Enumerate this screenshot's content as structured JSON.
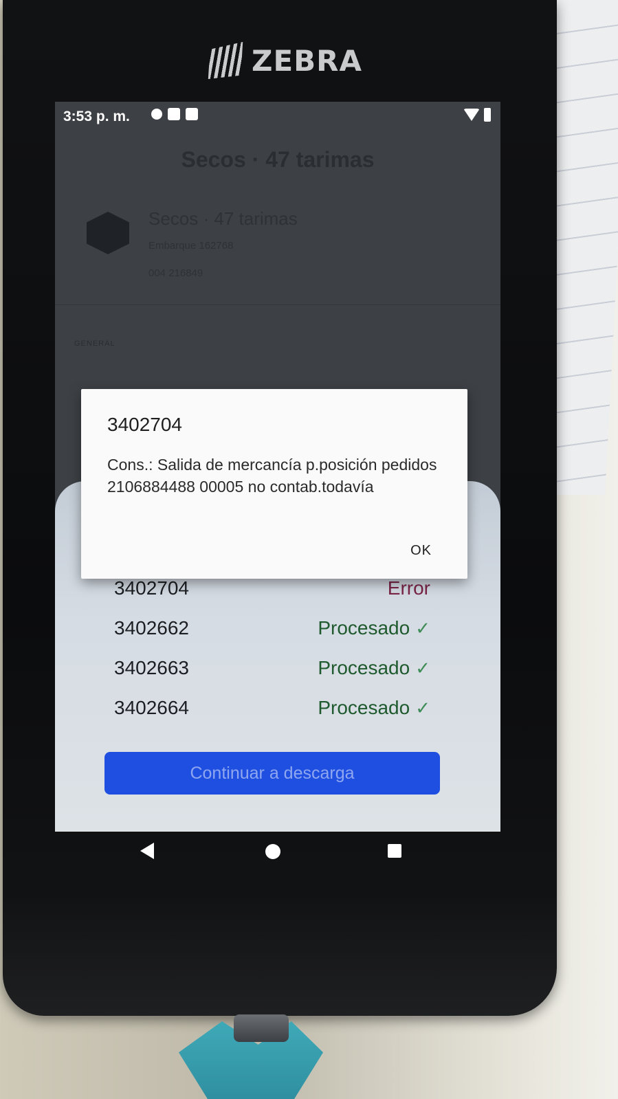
{
  "device": {
    "brand": "ZEBRA"
  },
  "statusbar": {
    "time": "3:53 p. m."
  },
  "background": {
    "title": "Secos · 47 tarimas",
    "card_title": "Secos · 47 tarimas",
    "card_sub1": "Embarque 162768",
    "card_sub2": "004 216849",
    "section_label": "GENERAL"
  },
  "dialog": {
    "title": "3402704",
    "message": "Cons.: Salida de mercancía p.posición pedidos 2106884488 00005 no contab.todavía",
    "ok_label": "OK"
  },
  "results": [
    {
      "id": "3402704",
      "status": "Error",
      "kind": "error"
    },
    {
      "id": "3402662",
      "status": "Procesado",
      "kind": "ok"
    },
    {
      "id": "3402663",
      "status": "Procesado",
      "kind": "ok"
    },
    {
      "id": "3402664",
      "status": "Procesado",
      "kind": "ok"
    }
  ],
  "cta": {
    "label": "Continuar a descarga"
  },
  "icons": {
    "check": "check-icon",
    "back": "nav-back-icon",
    "home": "nav-home-icon",
    "recent": "nav-recent-icon"
  },
  "colors": {
    "error": "#7a2446",
    "ok": "#1f5a2e",
    "primary": "#1f4fe0"
  }
}
